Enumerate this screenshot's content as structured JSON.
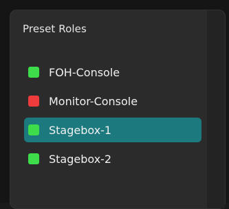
{
  "panel": {
    "title": "Preset Roles"
  },
  "roles": [
    {
      "label": "FOH-Console",
      "status_color": "#3ddc4a",
      "selected": false
    },
    {
      "label": "Monitor-Console",
      "status_color": "#ee3b3b",
      "selected": false
    },
    {
      "label": "Stagebox-1",
      "status_color": "#3ddc4a",
      "selected": true
    },
    {
      "label": "Stagebox-2",
      "status_color": "#3ddc4a",
      "selected": false
    }
  ],
  "colors": {
    "ok": "#3ddc4a",
    "error": "#ee3b3b",
    "selected_bg": "#1c7a7f",
    "panel_bg": "#2b2b2b"
  }
}
